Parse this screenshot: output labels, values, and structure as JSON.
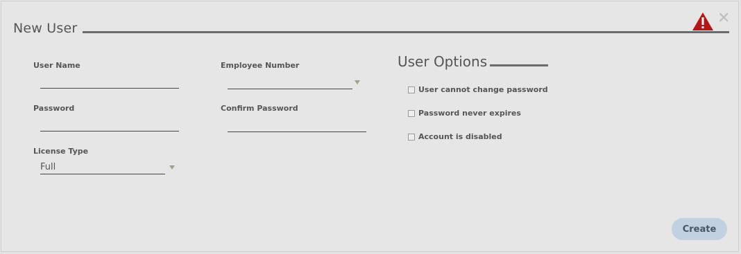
{
  "dialog": {
    "title": "New User",
    "close_icon": "close-icon",
    "warning_icon": "warning-icon",
    "warning_color": "#b01818"
  },
  "form": {
    "user_name": {
      "label": "User Name",
      "value": ""
    },
    "employee_number": {
      "label": "Employee Number",
      "value": ""
    },
    "password": {
      "label": "Password",
      "value": ""
    },
    "confirm_password": {
      "label": "Confirm Password",
      "value": ""
    },
    "license_type": {
      "label": "License Type",
      "value": "Full"
    }
  },
  "user_options": {
    "title": "User Options",
    "items": [
      {
        "label": "User cannot change password",
        "checked": false
      },
      {
        "label": "Password never expires",
        "checked": false
      },
      {
        "label": "Account is disabled",
        "checked": false
      }
    ]
  },
  "actions": {
    "create_label": "Create",
    "create_color": "#c2d1e2"
  }
}
